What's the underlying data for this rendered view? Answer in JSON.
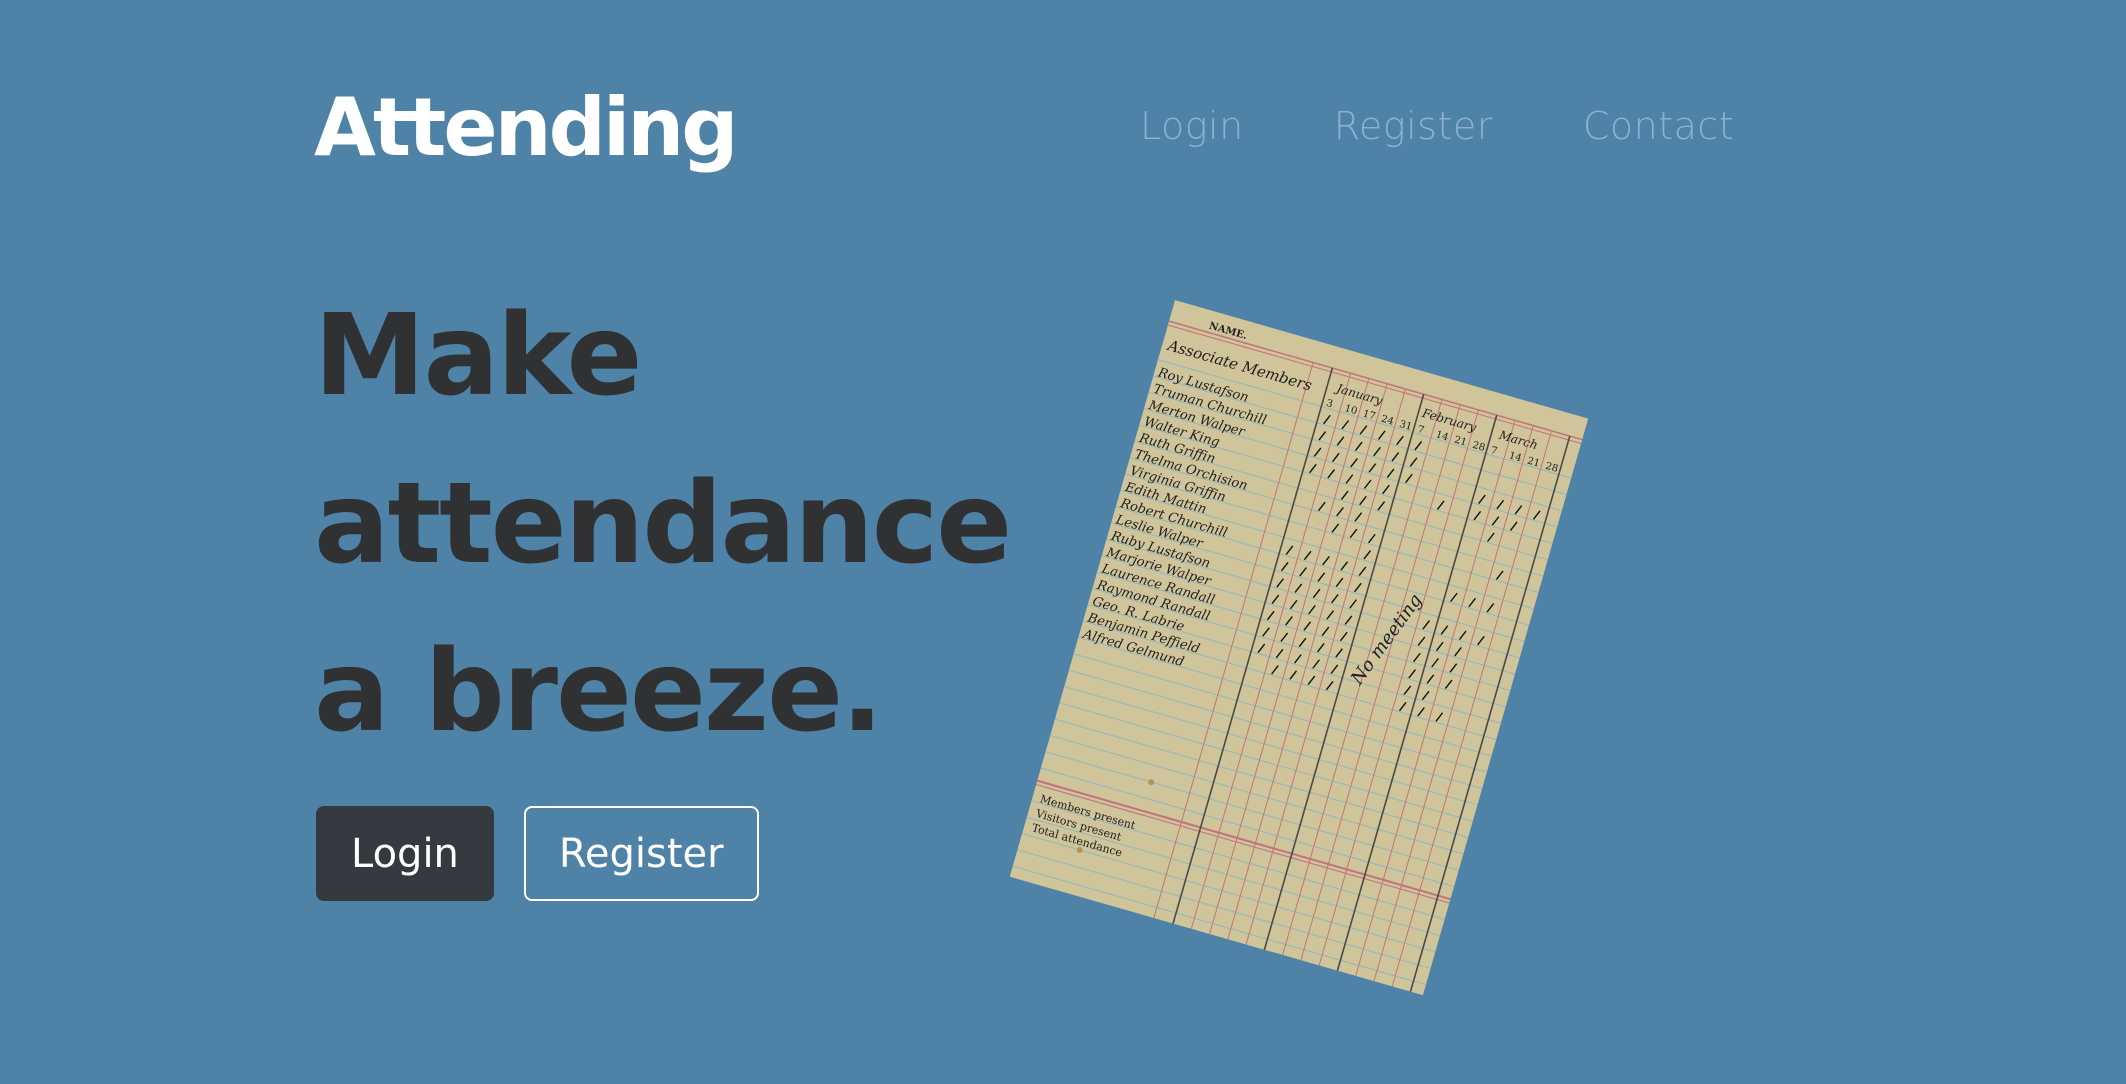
{
  "brand": {
    "name": "Attending"
  },
  "nav": {
    "items": [
      "Login",
      "Register",
      "Contact"
    ]
  },
  "hero": {
    "headline_lines": [
      "Make",
      "attendance",
      "a breeze."
    ],
    "login_label": "Login",
    "register_label": "Register"
  },
  "ledger": {
    "name_label": "NAME.",
    "section_label": "Associate Members",
    "months": [
      "January",
      "February",
      "March"
    ],
    "day_headers": [
      "3",
      "10",
      "17",
      "24",
      "31",
      "7",
      "14",
      "21",
      "28",
      "7",
      "14",
      "21",
      "28"
    ],
    "names": [
      "Roy Lustafson",
      "Truman Churchill",
      "Merton Walper",
      "Walter King",
      "Ruth Griffin",
      "Thelma Orchision",
      "Virginia Griffin",
      "Edith Mattin",
      "Robert Churchill",
      "Leslie Walper",
      "Ruby Lustafson",
      "Marjorie Walper",
      "Laurence Randall",
      "Raymond Randall",
      "Geo. R. Labrie",
      "Benjamin Peffield",
      "Alfred Gelmund"
    ],
    "footer_labels": [
      "Members present",
      "Visitors present",
      "Total attendance"
    ],
    "margin_note": "No meeting"
  },
  "colors": {
    "background": "#4e82a6",
    "headline": "#2f3133",
    "button_dark": "#343a40",
    "paper": "#cfc49a",
    "red_rule": "#c4727a",
    "blue_rule": "#8fb7bd"
  }
}
